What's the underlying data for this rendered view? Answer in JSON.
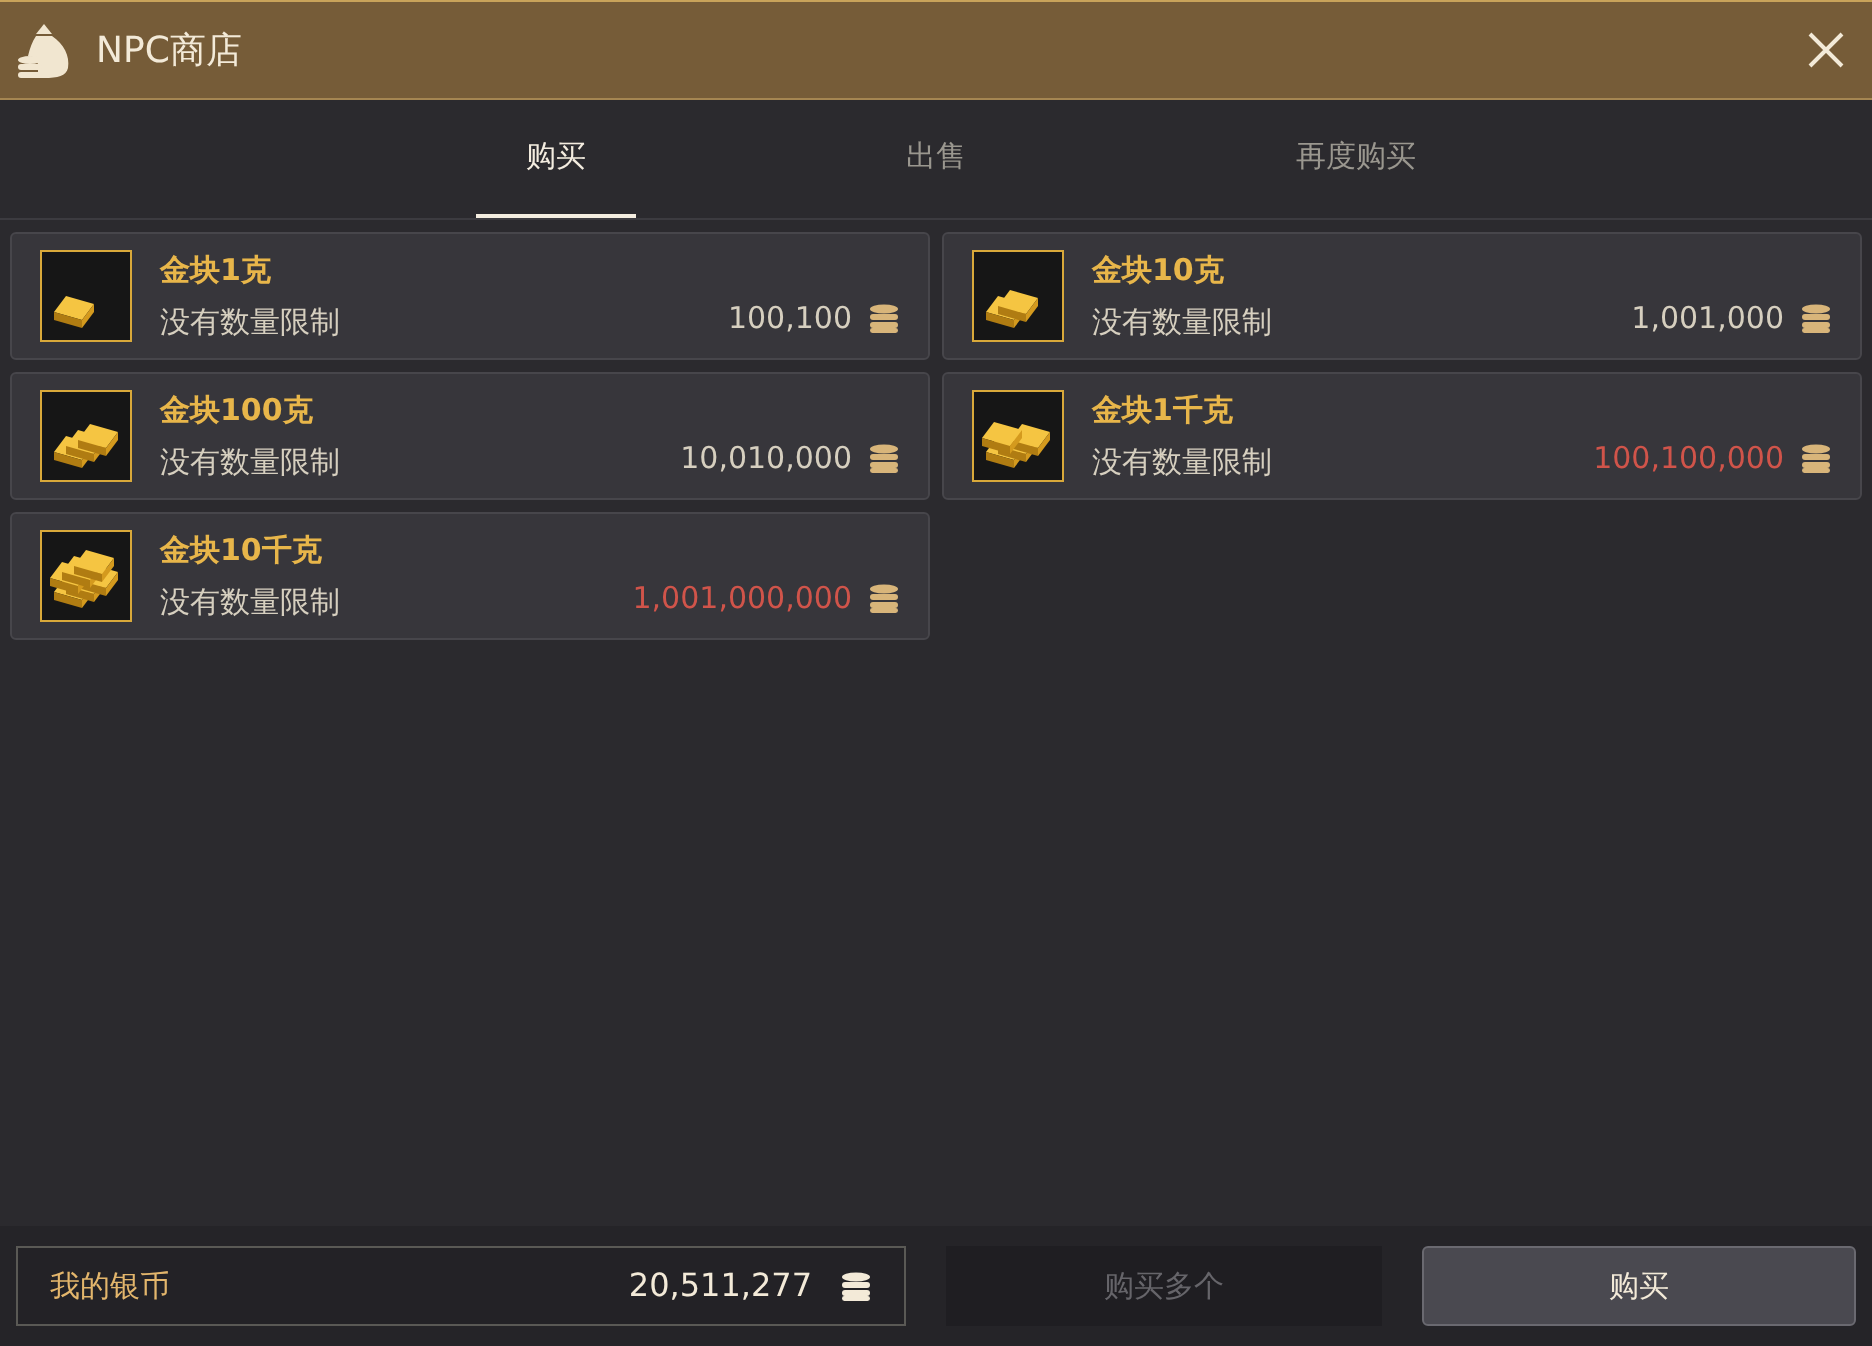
{
  "window": {
    "title": "NPC商店"
  },
  "tabs": [
    {
      "label": "购买",
      "selected": true
    },
    {
      "label": "出售",
      "selected": false
    },
    {
      "label": "再度购买",
      "selected": false
    }
  ],
  "items": [
    {
      "name": "金块1克",
      "limit": "没有数量限制",
      "price": "100,100",
      "affordable": true
    },
    {
      "name": "金块10克",
      "limit": "没有数量限制",
      "price": "1,001,000",
      "affordable": true
    },
    {
      "name": "金块100克",
      "limit": "没有数量限制",
      "price": "10,010,000",
      "affordable": true
    },
    {
      "name": "金块1千克",
      "limit": "没有数量限制",
      "price": "100,100,000",
      "affordable": false
    },
    {
      "name": "金块10千克",
      "limit": "没有数量限制",
      "price": "1,001,000,000",
      "affordable": false
    }
  ],
  "wallet": {
    "label": "我的银币",
    "amount": "20,511,277"
  },
  "buttons": [
    {
      "label": "购买多个",
      "disabled": true
    },
    {
      "label": "购买",
      "disabled": false
    }
  ]
}
